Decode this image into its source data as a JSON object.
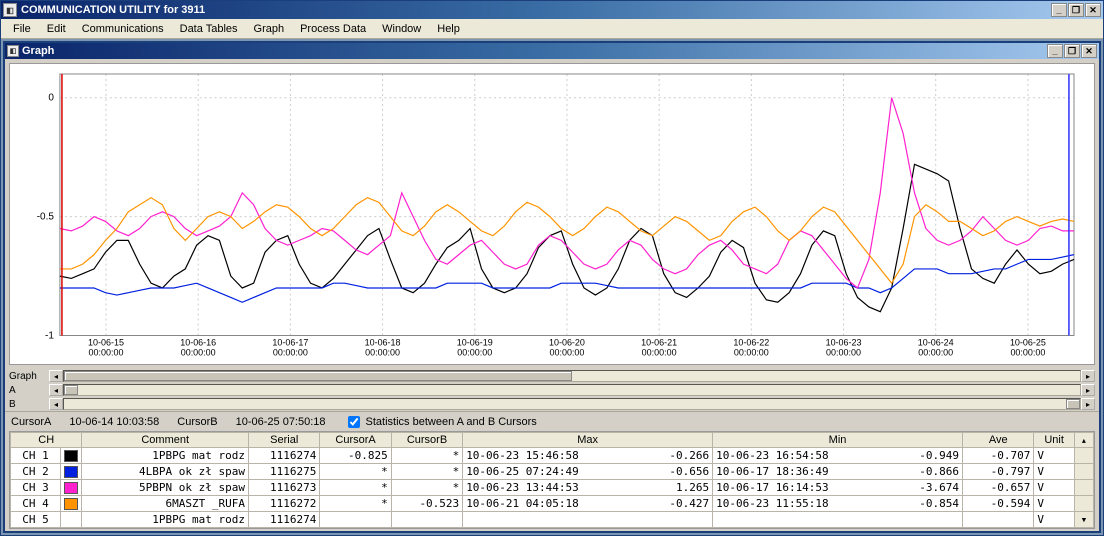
{
  "app": {
    "title": "COMMUNICATION UTILITY for 3911",
    "menus": [
      "File",
      "Edit",
      "Communications",
      "Data Tables",
      "Graph",
      "Process Data",
      "Window",
      "Help"
    ]
  },
  "inner": {
    "title": "Graph"
  },
  "cursors": {
    "aLabel": "CursorA",
    "aValue": "10-06-14 10:03:58",
    "bLabel": "CursorB",
    "bValue": "10-06-25 07:50:18",
    "statsChecked": true,
    "statsLabel": "Statistics between A and B Cursors",
    "graphLabel": "Graph",
    "abLabelA": "A",
    "abLabelB": "B"
  },
  "table": {
    "headers": {
      "ch": "CH",
      "comment": "Comment",
      "serial": "Serial",
      "cursorA": "CursorA",
      "cursorB": "CursorB",
      "max": "Max",
      "min": "Min",
      "ave": "Ave",
      "unit": "Unit"
    },
    "rows": [
      {
        "ch": "CH 1",
        "color": "#000000",
        "comment": "1PBPG mat rodz",
        "serial": "1116274",
        "cursorA": "-0.825",
        "cursorB": "*",
        "max_ts": "10-06-23 15:46:58",
        "max_v": "-0.266",
        "min_ts": "10-06-23 16:54:58",
        "min_v": "-0.949",
        "ave": "-0.707",
        "unit": "V"
      },
      {
        "ch": "CH 2",
        "color": "#0020e0",
        "comment": "4LBPA ok zł spaw",
        "serial": "1116275",
        "cursorA": "*",
        "cursorB": "*",
        "max_ts": "10-06-25 07:24:49",
        "max_v": "-0.656",
        "min_ts": "10-06-17 18:36:49",
        "min_v": "-0.866",
        "ave": "-0.797",
        "unit": "V"
      },
      {
        "ch": "CH 3",
        "color": "#ff20d0",
        "comment": "5PBPN ok zł spaw",
        "serial": "1116273",
        "cursorA": "*",
        "cursorB": "*",
        "max_ts": "10-06-23 13:44:53",
        "max_v": "1.265",
        "min_ts": "10-06-17 16:14:53",
        "min_v": "-3.674",
        "ave": "-0.657",
        "unit": "V"
      },
      {
        "ch": "CH 4",
        "color": "#ff9400",
        "comment": "6MASZT _RUFA",
        "serial": "1116272",
        "cursorA": "*",
        "cursorB": "-0.523",
        "max_ts": "10-06-21 04:05:18",
        "max_v": "-0.427",
        "min_ts": "10-06-23 11:55:18",
        "min_v": "-0.854",
        "ave": "-0.594",
        "unit": "V"
      },
      {
        "ch": "CH 5",
        "color": "",
        "comment": "1PBPG mat rodz",
        "serial": "1116274",
        "cursorA": "",
        "cursorB": "",
        "max_ts": "",
        "max_v": "",
        "min_ts": "",
        "min_v": "",
        "ave": "",
        "unit": "V"
      }
    ]
  },
  "chart_data": {
    "type": "line",
    "title": "",
    "xlabel": "",
    "ylabel": "",
    "ylim": [
      -1.0,
      0.1
    ],
    "yticks": [
      0,
      -0.5,
      -1
    ],
    "xticks": [
      "10-06-15\n00:00:00",
      "10-06-16\n00:00:00",
      "10-06-17\n00:00:00",
      "10-06-18\n00:00:00",
      "10-06-19\n00:00:00",
      "10-06-20\n00:00:00",
      "10-06-21\n00:00:00",
      "10-06-22\n00:00:00",
      "10-06-23\n00:00:00",
      "10-06-24\n00:00:00",
      "10-06-25\n00:00:00"
    ],
    "cursorA_x": 0.002,
    "cursorB_x": 0.995,
    "series": [
      {
        "name": "CH1",
        "color": "#000000",
        "values": [
          -0.75,
          -0.76,
          -0.74,
          -0.72,
          -0.65,
          -0.6,
          -0.6,
          -0.7,
          -0.78,
          -0.8,
          -0.75,
          -0.72,
          -0.62,
          -0.58,
          -0.6,
          -0.75,
          -0.8,
          -0.78,
          -0.65,
          -0.6,
          -0.58,
          -0.7,
          -0.78,
          -0.8,
          -0.76,
          -0.7,
          -0.64,
          -0.58,
          -0.55,
          -0.68,
          -0.8,
          -0.82,
          -0.78,
          -0.7,
          -0.63,
          -0.6,
          -0.55,
          -0.72,
          -0.8,
          -0.82,
          -0.8,
          -0.74,
          -0.63,
          -0.58,
          -0.56,
          -0.7,
          -0.8,
          -0.83,
          -0.8,
          -0.72,
          -0.6,
          -0.55,
          -0.58,
          -0.74,
          -0.82,
          -0.84,
          -0.8,
          -0.75,
          -0.65,
          -0.6,
          -0.63,
          -0.78,
          -0.85,
          -0.86,
          -0.82,
          -0.74,
          -0.62,
          -0.56,
          -0.58,
          -0.74,
          -0.84,
          -0.88,
          -0.9,
          -0.8,
          -0.55,
          -0.28,
          -0.3,
          -0.32,
          -0.35,
          -0.55,
          -0.72,
          -0.76,
          -0.78,
          -0.7,
          -0.64,
          -0.7,
          -0.74,
          -0.73,
          -0.7,
          -0.68
        ]
      },
      {
        "name": "CH2",
        "color": "#0020e0",
        "values": [
          -0.8,
          -0.8,
          -0.8,
          -0.8,
          -0.82,
          -0.83,
          -0.82,
          -0.81,
          -0.8,
          -0.8,
          -0.8,
          -0.79,
          -0.78,
          -0.8,
          -0.82,
          -0.84,
          -0.86,
          -0.84,
          -0.82,
          -0.8,
          -0.8,
          -0.8,
          -0.8,
          -0.8,
          -0.78,
          -0.78,
          -0.79,
          -0.8,
          -0.8,
          -0.8,
          -0.8,
          -0.8,
          -0.8,
          -0.8,
          -0.78,
          -0.78,
          -0.78,
          -0.78,
          -0.8,
          -0.8,
          -0.8,
          -0.8,
          -0.8,
          -0.8,
          -0.78,
          -0.78,
          -0.78,
          -0.78,
          -0.79,
          -0.8,
          -0.8,
          -0.8,
          -0.8,
          -0.8,
          -0.8,
          -0.8,
          -0.8,
          -0.8,
          -0.8,
          -0.8,
          -0.8,
          -0.8,
          -0.8,
          -0.8,
          -0.8,
          -0.8,
          -0.78,
          -0.78,
          -0.78,
          -0.78,
          -0.8,
          -0.8,
          -0.82,
          -0.8,
          -0.76,
          -0.72,
          -0.72,
          -0.72,
          -0.74,
          -0.74,
          -0.74,
          -0.73,
          -0.72,
          -0.72,
          -0.7,
          -0.68,
          -0.68,
          -0.68,
          -0.67,
          -0.66
        ]
      },
      {
        "name": "CH3",
        "color": "#ff20d0",
        "values": [
          -0.55,
          -0.56,
          -0.54,
          -0.5,
          -0.52,
          -0.56,
          -0.58,
          -0.55,
          -0.5,
          -0.48,
          -0.5,
          -0.55,
          -0.58,
          -0.56,
          -0.54,
          -0.5,
          -0.4,
          -0.45,
          -0.55,
          -0.6,
          -0.62,
          -0.6,
          -0.58,
          -0.55,
          -0.56,
          -0.6,
          -0.64,
          -0.66,
          -0.62,
          -0.58,
          -0.4,
          -0.5,
          -0.6,
          -0.68,
          -0.7,
          -0.66,
          -0.62,
          -0.6,
          -0.65,
          -0.7,
          -0.72,
          -0.7,
          -0.62,
          -0.58,
          -0.6,
          -0.65,
          -0.7,
          -0.72,
          -0.7,
          -0.64,
          -0.6,
          -0.62,
          -0.68,
          -0.72,
          -0.74,
          -0.72,
          -0.66,
          -0.62,
          -0.6,
          -0.64,
          -0.7,
          -0.72,
          -0.74,
          -0.7,
          -0.6,
          -0.56,
          -0.58,
          -0.64,
          -0.7,
          -0.76,
          -0.8,
          -0.68,
          -0.4,
          -0.0,
          -0.15,
          -0.4,
          -0.55,
          -0.6,
          -0.62,
          -0.6,
          -0.56,
          -0.5,
          -0.55,
          -0.6,
          -0.62,
          -0.6,
          -0.55,
          -0.54,
          -0.56,
          -0.56
        ]
      },
      {
        "name": "CH4",
        "color": "#ff9400",
        "values": [
          -0.72,
          -0.72,
          -0.7,
          -0.66,
          -0.6,
          -0.55,
          -0.48,
          -0.45,
          -0.42,
          -0.45,
          -0.55,
          -0.6,
          -0.55,
          -0.5,
          -0.48,
          -0.5,
          -0.55,
          -0.52,
          -0.48,
          -0.45,
          -0.46,
          -0.5,
          -0.55,
          -0.58,
          -0.55,
          -0.5,
          -0.45,
          -0.42,
          -0.44,
          -0.5,
          -0.56,
          -0.58,
          -0.54,
          -0.48,
          -0.45,
          -0.48,
          -0.52,
          -0.56,
          -0.58,
          -0.54,
          -0.48,
          -0.44,
          -0.46,
          -0.5,
          -0.55,
          -0.58,
          -0.55,
          -0.5,
          -0.46,
          -0.48,
          -0.52,
          -0.56,
          -0.58,
          -0.54,
          -0.5,
          -0.52,
          -0.56,
          -0.6,
          -0.58,
          -0.52,
          -0.48,
          -0.46,
          -0.5,
          -0.56,
          -0.6,
          -0.56,
          -0.5,
          -0.46,
          -0.48,
          -0.54,
          -0.6,
          -0.66,
          -0.72,
          -0.78,
          -0.7,
          -0.5,
          -0.45,
          -0.48,
          -0.52,
          -0.52,
          -0.55,
          -0.58,
          -0.56,
          -0.52,
          -0.5,
          -0.52,
          -0.54,
          -0.52,
          -0.51,
          -0.52
        ]
      }
    ]
  }
}
